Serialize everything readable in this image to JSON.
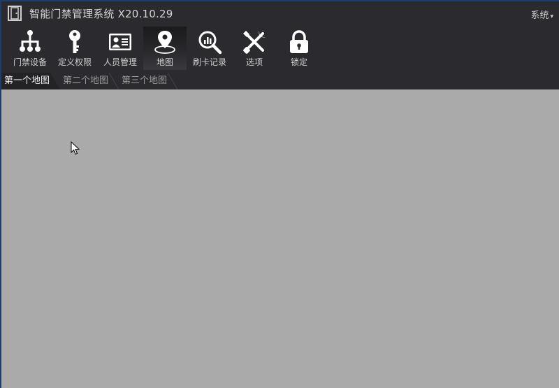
{
  "window": {
    "title": "智能门禁管理系统 X20.10.29",
    "system_menu": "系统",
    "menu_caret": "▾"
  },
  "toolbar": {
    "items": [
      {
        "label": "门禁设备",
        "icon": "network-icon",
        "active": false
      },
      {
        "label": "定义权限",
        "icon": "key-icon",
        "active": false
      },
      {
        "label": "人员管理",
        "icon": "id-card-icon",
        "active": false
      },
      {
        "label": "地图",
        "icon": "map-pin-icon",
        "active": true
      },
      {
        "label": "刷卡记录",
        "icon": "search-chart-icon",
        "active": false
      },
      {
        "label": "选项",
        "icon": "tools-icon",
        "active": false
      },
      {
        "label": "锁定",
        "icon": "lock-icon",
        "active": false
      }
    ]
  },
  "tabs": [
    {
      "label": "第一个地图",
      "active": true
    },
    {
      "label": "第二个地图",
      "active": false
    },
    {
      "label": "第三个地图",
      "active": false
    }
  ],
  "colors": {
    "chrome": "#2b2b2f",
    "content": "#a9aaa9",
    "border": "#1f3d66",
    "icon": "#ffffff"
  }
}
